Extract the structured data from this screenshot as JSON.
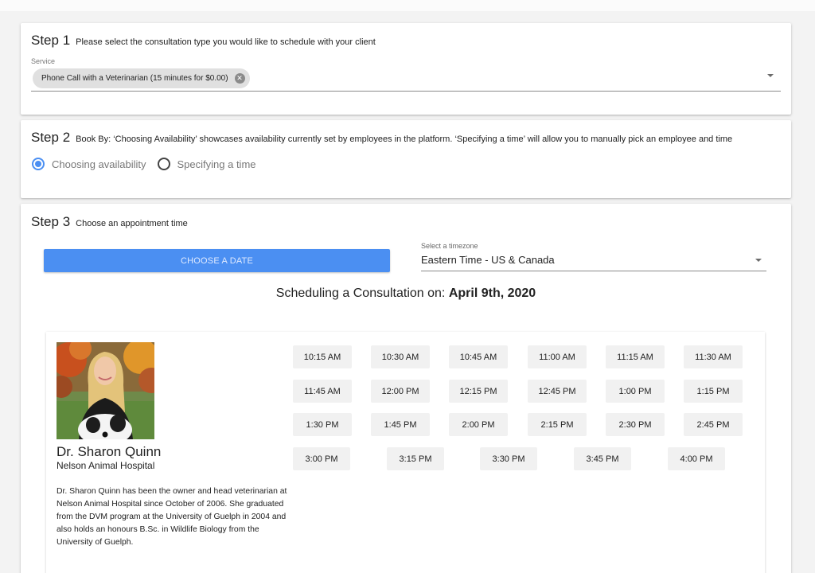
{
  "step1": {
    "number": "Step 1",
    "description": "Please select the consultation type you would like to schedule with your client",
    "service_label": "Service",
    "service_chip": "Phone Call with a Veterinarian (15 minutes for $0.00)"
  },
  "step2": {
    "number": "Step 2",
    "description": "Book By: ‘Choosing Availability’ showcases availability currently set by employees in the platform. ‘Specifying a time’ will allow you to manually pick an employee and time",
    "options": [
      {
        "label": "Choosing availability",
        "selected": true
      },
      {
        "label": "Specifying a time",
        "selected": false
      }
    ]
  },
  "step3": {
    "number": "Step 3",
    "description": "Choose an appointment time",
    "choose_date_label": "CHOOSE A DATE",
    "timezone_label": "Select a timezone",
    "timezone_value": "Eastern Time - US & Canada",
    "scheduling_prefix": "Scheduling a Consultation on: ",
    "scheduling_date": "April 9th, 2020"
  },
  "doctor": {
    "name": "Dr. Sharon Quinn",
    "organization": "Nelson Animal Hospital",
    "bio": "Dr. Sharon Quinn has been the owner and head veterinarian at Nelson Animal Hospital since October of 2006. She graduated from the DVM program at the University of Guelph in 2004 and also holds an honours B.Sc. in Wildlife Biology from the University of Guelph."
  },
  "time_slots": [
    [
      "10:15 AM",
      "10:30 AM",
      "10:45 AM",
      "11:00 AM",
      "11:15 AM",
      "11:30 AM"
    ],
    [
      "11:45 AM",
      "12:00 PM",
      "12:15 PM",
      "12:45 PM",
      "1:00 PM",
      "1:15 PM"
    ],
    [
      "1:30 PM",
      "1:45 PM",
      "2:00 PM",
      "2:15 PM",
      "2:30 PM",
      "2:45 PM"
    ],
    [
      "3:00 PM",
      "3:15 PM",
      "3:30 PM",
      "3:45 PM",
      "4:00 PM"
    ]
  ],
  "colors": {
    "accent": "#4b8ff2",
    "chip_background": "#e0e0e0",
    "slot_background": "#f1f1f1"
  }
}
